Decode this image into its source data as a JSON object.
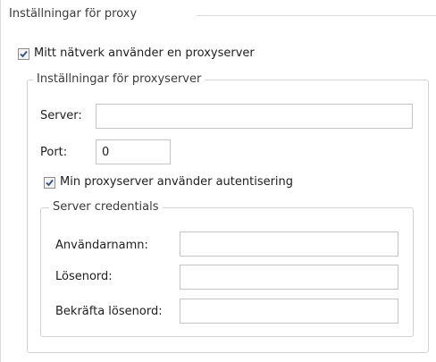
{
  "proxy_settings": {
    "title": "Inställningar för proxy",
    "use_proxy": {
      "label": "Mitt nätverk använder en proxyserver",
      "checked": true
    },
    "server_group": {
      "title": "Inställningar för proxyserver",
      "server": {
        "label": "Server:",
        "value": ""
      },
      "port": {
        "label": "Port:",
        "value": "0"
      },
      "auth": {
        "label": "Min proxyserver använder autentisering",
        "checked": true
      },
      "credentials": {
        "title": "Server credentials",
        "username": {
          "label": "Användarnamn:",
          "value": ""
        },
        "password": {
          "label": "Lösenord:",
          "value": ""
        },
        "confirm_password": {
          "label": "Bekräfta lösenord:",
          "value": ""
        }
      }
    }
  },
  "icons": {
    "checkbox_check": "check-mark"
  },
  "colors": {
    "check": "#2d4f86",
    "border": "#d3d3d3",
    "field_border": "#c4c4c4"
  }
}
